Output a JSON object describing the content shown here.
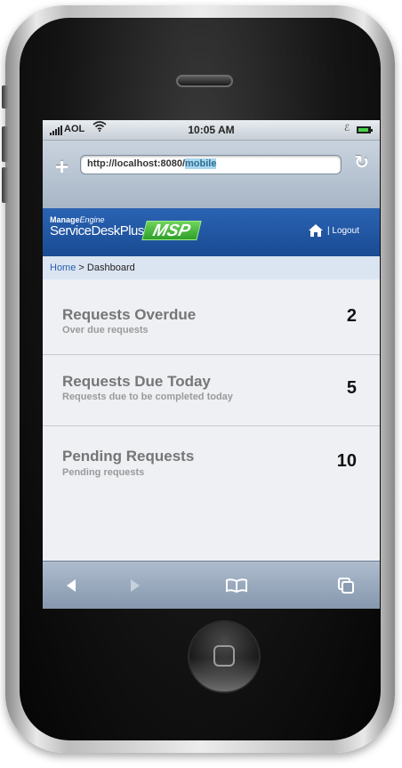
{
  "status_bar": {
    "carrier": "AOL",
    "time": "10:05 AM",
    "bluetooth": "ℰ"
  },
  "browser": {
    "url_prefix": "http://localhost:8080/",
    "url_highlight": "mobile",
    "add_glyph": "+",
    "reload_glyph": "↻"
  },
  "header": {
    "brand_manage": "Manage",
    "brand_engine": "Engine",
    "product": "ServiceDeskPlus",
    "msp_badge": "MSP",
    "logout_label": "| Logout"
  },
  "breadcrumb": {
    "home": "Home",
    "separator": ">",
    "current": "Dashboard"
  },
  "requests": [
    {
      "title": "Requests Overdue",
      "subtitle": "Over due requests",
      "count": "2"
    },
    {
      "title": "Requests Due Today",
      "subtitle": "Requests due to be completed today",
      "count": "5"
    },
    {
      "title": "Pending Requests",
      "subtitle": "Pending requests",
      "count": "10"
    }
  ],
  "toolbar": {
    "back_icon": "back-arrow-icon",
    "forward_icon": "forward-arrow-icon",
    "bookmarks_icon": "bookmarks-book-icon",
    "pages_icon": "pages-icon"
  },
  "colors": {
    "header_blue": "#1f56a3",
    "msp_green": "#3fb33a",
    "breadcrumb_bg": "#dbe5f2",
    "row_bg": "#eef0f3"
  }
}
